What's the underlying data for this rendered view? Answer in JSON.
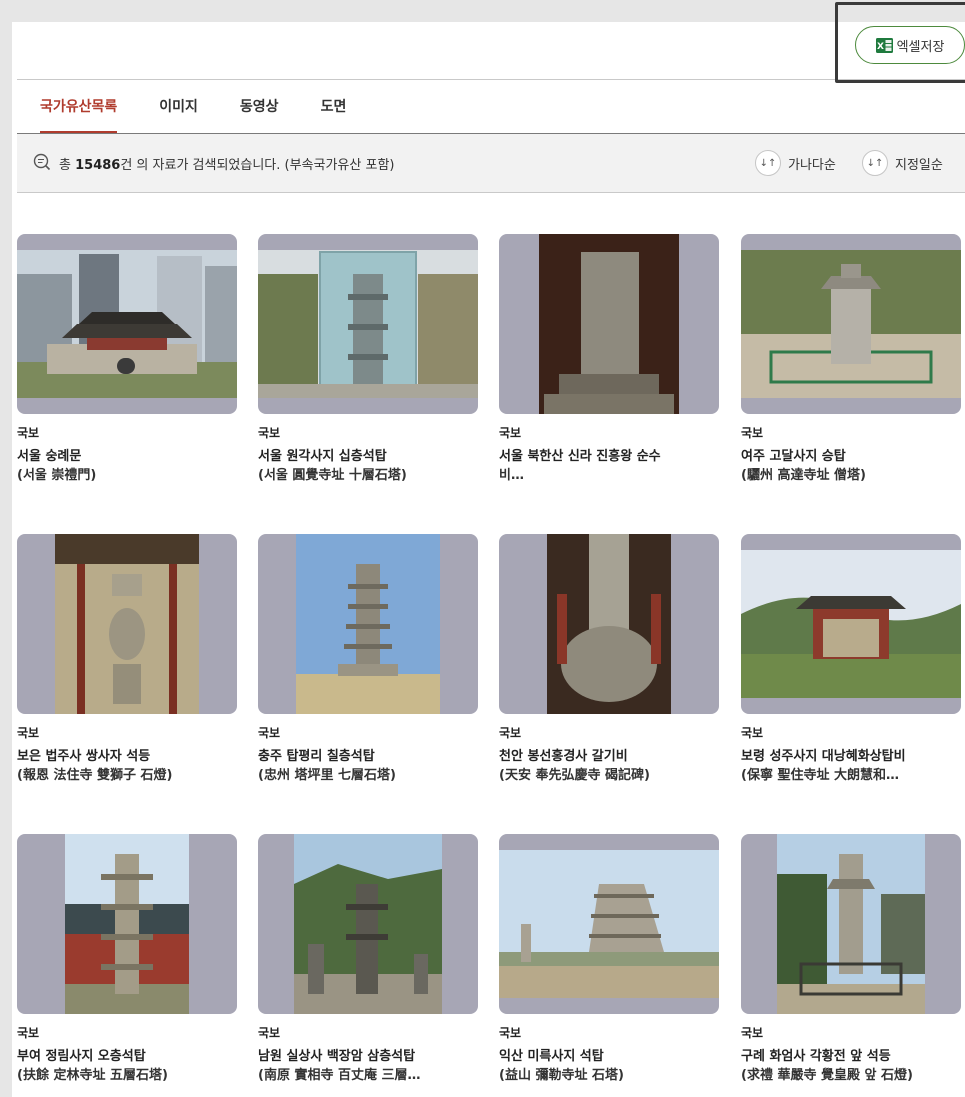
{
  "toolbar": {
    "excel_label": "엑셀저장",
    "excel_icon": "excel-icon"
  },
  "tabs": [
    {
      "label": "국가유산목록",
      "active": true
    },
    {
      "label": "이미지",
      "active": false
    },
    {
      "label": "동영상",
      "active": false
    },
    {
      "label": "도면",
      "active": false
    }
  ],
  "results": {
    "prefix": "총",
    "count": "15486",
    "suffix": "건 의 자료가 검색되었습니다. (부속국가유산 포함)"
  },
  "sort": [
    {
      "label": "가나다순",
      "icon": "sort-arrows-icon"
    },
    {
      "label": "지정일순",
      "icon": "sort-arrows-icon"
    }
  ],
  "colors": {
    "accent": "#b03c2e",
    "excel_border": "#4d8a3d",
    "thumb_bg": "#a7a6b5"
  },
  "items": [
    {
      "category": "국보",
      "name": "서울 숭례문",
      "sub": "(서울 崇禮門)"
    },
    {
      "category": "국보",
      "name": "서울 원각사지 십층석탑",
      "sub": "(서울 圓覺寺址 十層石塔)"
    },
    {
      "category": "국보",
      "name": "서울 북한산 신라 진흥왕 순수",
      "sub": "비…"
    },
    {
      "category": "국보",
      "name": "여주 고달사지 승탑",
      "sub": "(驪州 高達寺址 僧塔)"
    },
    {
      "category": "국보",
      "name": "보은 법주사 쌍사자 석등",
      "sub": "(報恩 法住寺 雙獅子 石燈)"
    },
    {
      "category": "국보",
      "name": "충주 탑평리 칠층석탑",
      "sub": "(忠州 塔坪里 七層石塔)"
    },
    {
      "category": "국보",
      "name": "천안 봉선홍경사 갈기비",
      "sub": "(天安 奉先弘慶寺 碣記碑)"
    },
    {
      "category": "국보",
      "name": "보령 성주사지 대낭혜화상탑비",
      "sub": "(保寧 聖住寺址 大朗慧和…"
    },
    {
      "category": "국보",
      "name": "부여 정림사지 오층석탑",
      "sub": "(扶餘 定林寺址 五層石塔)"
    },
    {
      "category": "국보",
      "name": "남원 실상사 백장암 삼층석탑",
      "sub": "(南原 實相寺 百丈庵 三層…"
    },
    {
      "category": "국보",
      "name": "익산 미륵사지 석탑",
      "sub": "(益山 彌勒寺址 石塔)"
    },
    {
      "category": "국보",
      "name": "구례 화엄사 각황전 앞 석등",
      "sub": "(求禮 華嚴寺 覺皇殿 앞 石燈)"
    }
  ]
}
